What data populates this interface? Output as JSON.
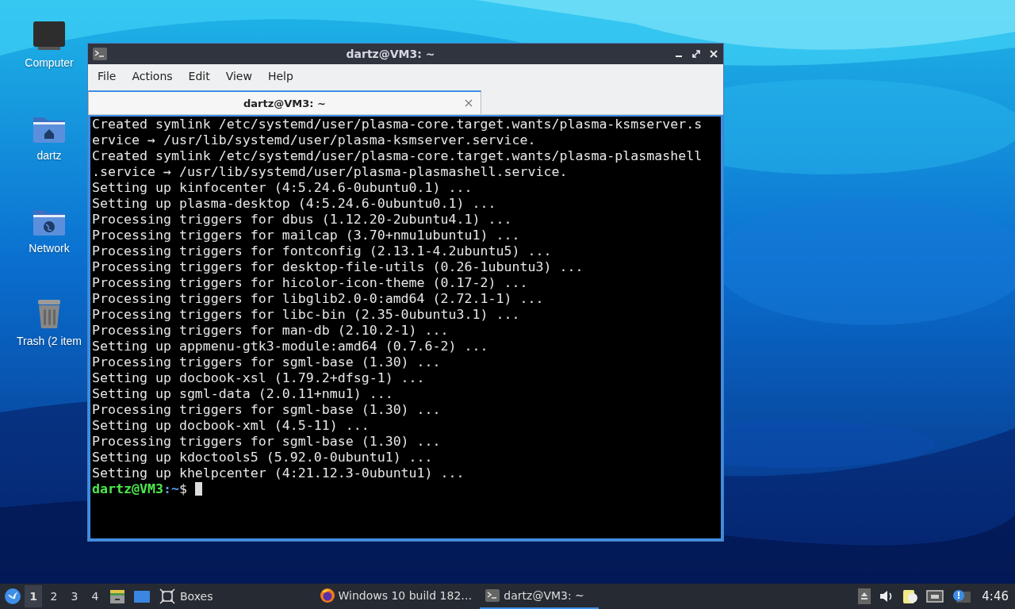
{
  "desktop": {
    "icons": [
      {
        "label": "Computer",
        "kind": "computer"
      },
      {
        "label": "dartz",
        "kind": "home"
      },
      {
        "label": "Network",
        "kind": "network"
      },
      {
        "label": "Trash (2 item",
        "kind": "trash"
      }
    ]
  },
  "window": {
    "title": "dartz@VM3: ~",
    "menu": [
      "File",
      "Actions",
      "Edit",
      "View",
      "Help"
    ],
    "tabs": [
      {
        "label": "dartz@VM3: ~",
        "selected": true
      }
    ],
    "terminal": {
      "lines": [
        "Created symlink /etc/systemd/user/plasma-core.target.wants/plasma-ksmserver.s",
        "ervice → /usr/lib/systemd/user/plasma-ksmserver.service.",
        "Created symlink /etc/systemd/user/plasma-core.target.wants/plasma-plasmashell",
        ".service → /usr/lib/systemd/user/plasma-plasmashell.service.",
        "Setting up kinfocenter (4:5.24.6-0ubuntu0.1) ...",
        "Setting up plasma-desktop (4:5.24.6-0ubuntu0.1) ...",
        "Processing triggers for dbus (1.12.20-2ubuntu4.1) ...",
        "Processing triggers for mailcap (3.70+nmu1ubuntu1) ...",
        "Processing triggers for fontconfig (2.13.1-4.2ubuntu5) ...",
        "Processing triggers for desktop-file-utils (0.26-1ubuntu3) ...",
        "Processing triggers for hicolor-icon-theme (0.17-2) ...",
        "Processing triggers for libglib2.0-0:amd64 (2.72.1-1) ...",
        "Processing triggers for libc-bin (2.35-0ubuntu3.1) ...",
        "Processing triggers for man-db (2.10.2-1) ...",
        "Setting up appmenu-gtk3-module:amd64 (0.7.6-2) ...",
        "Processing triggers for sgml-base (1.30) ...",
        "Setting up docbook-xsl (1.79.2+dfsg-1) ...",
        "Setting up sgml-data (2.0.11+nmu1) ...",
        "Processing triggers for sgml-base (1.30) ...",
        "Setting up docbook-xml (4.5-11) ...",
        "Processing triggers for sgml-base (1.30) ...",
        "Setting up kdoctools5 (5.92.0-0ubuntu1) ...",
        "Setting up khelpcenter (4:21.12.3-0ubuntu1) ..."
      ],
      "prompt": {
        "user_host": "dartz@VM3",
        "path": ":~",
        "symbol": "$"
      }
    }
  },
  "taskbar": {
    "workspaces": [
      {
        "label": "1",
        "selected": true
      },
      {
        "label": "2",
        "selected": false
      },
      {
        "label": "3",
        "selected": false
      },
      {
        "label": "4",
        "selected": false
      }
    ],
    "launchers": [
      {
        "kind": "files"
      },
      {
        "kind": "desktop"
      },
      {
        "kind": "boxes",
        "label": "Boxes"
      }
    ],
    "tasks": [
      {
        "label": "Windows 10 build 182…",
        "kind": "browser",
        "selected": false
      },
      {
        "label": "dartz@VM3: ~",
        "kind": "terminal",
        "selected": true
      }
    ],
    "clock": "4:46"
  }
}
